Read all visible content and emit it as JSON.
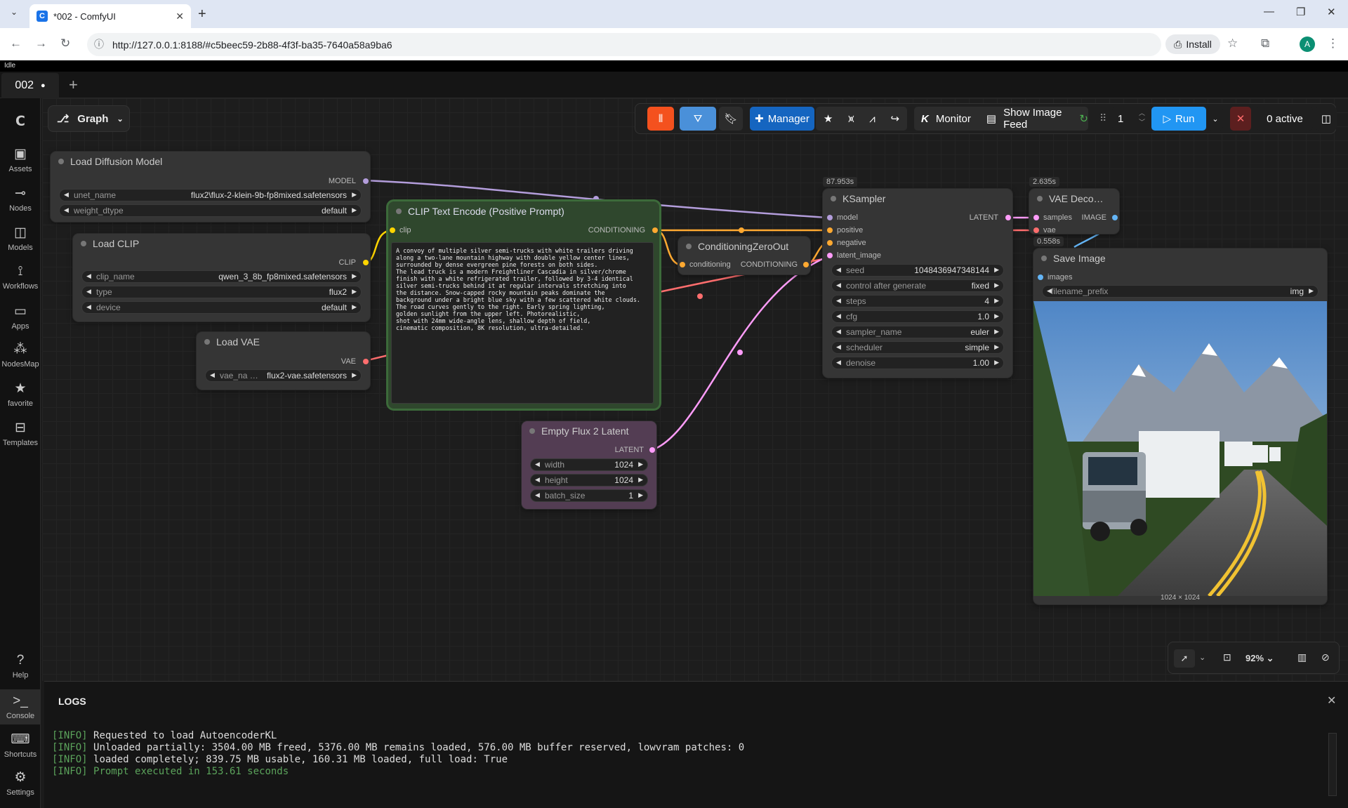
{
  "browser": {
    "tab_title": "*002 - ComfyUI",
    "favicon": "C",
    "url": "http://127.0.0.1:8188/#c5beec59-2b88-4f3f-ba35-7640a58a9ba6",
    "install_label": "Install",
    "avatar": "A"
  },
  "status": "Idle",
  "workflow_tab": {
    "label": "002",
    "modified_marker": "●"
  },
  "graph_label": "Graph",
  "sidebar": [
    {
      "label": "Assets",
      "icon": "image-icon"
    },
    {
      "label": "Nodes",
      "icon": "nodes-icon"
    },
    {
      "label": "Models",
      "icon": "models-icon"
    },
    {
      "label": "Workflows",
      "icon": "workflows-icon"
    },
    {
      "label": "Apps",
      "icon": "apps-icon"
    },
    {
      "label": "NodesMap",
      "icon": "nodesmap-icon"
    },
    {
      "label": "favorite",
      "icon": "star-icon"
    },
    {
      "label": "Templates",
      "icon": "templates-icon"
    },
    {
      "label": "Help",
      "icon": "help-icon"
    },
    {
      "label": "Console",
      "icon": "terminal-icon"
    },
    {
      "label": "Shortcuts",
      "icon": "keyboard-icon"
    },
    {
      "label": "Settings",
      "icon": "gear-icon"
    }
  ],
  "toolbar": {
    "manager": "Manager",
    "monitor": "Monitor",
    "show_image_feed": "Show Image Feed",
    "queue_count": "1",
    "run": "Run",
    "active": "0 active"
  },
  "nodes": {
    "load_diffusion": {
      "title": "Load Diffusion Model",
      "output": "MODEL",
      "unet_name_label": "unet_name",
      "unet_name": "flux2\\flux-2-klein-9b-fp8mixed.safetensors",
      "weight_dtype_label": "weight_dtype",
      "weight_dtype": "default"
    },
    "load_clip": {
      "title": "Load CLIP",
      "output": "CLIP",
      "clip_name_label": "clip_name",
      "clip_name": "qwen_3_8b_fp8mixed.safetensors",
      "type_label": "type",
      "type": "flux2",
      "device_label": "device",
      "device": "default"
    },
    "load_vae": {
      "title": "Load VAE",
      "output": "VAE",
      "vae_name_label": "vae_na …",
      "vae_name": "flux2-vae.safetensors"
    },
    "clip_encode": {
      "title": "CLIP Text Encode (Positive Prompt)",
      "input": "clip",
      "output": "CONDITIONING",
      "prompt": "A convoy of multiple silver semi-trucks with white trailers driving\nalong a two-lane mountain highway with double yellow center lines,\nsurrounded by dense evergreen pine forests on both sides.\nThe lead truck is a modern Freightliner Cascadia in silver/chrome\nfinish with a white refrigerated trailer, followed by 3-4 identical\nsilver semi-trucks behind it at regular intervals stretching into\nthe distance. Snow-capped rocky mountain peaks dominate the\nbackground under a bright blue sky with a few scattered white clouds.\nThe road curves gently to the right. Early spring lighting,\ngolden sunlight from the upper left. Photorealistic,\nshot with 24mm wide-angle lens, shallow depth of field,\ncinematic composition, 8K resolution, ultra-detailed."
    },
    "cond_zero": {
      "title": "ConditioningZeroOut",
      "input": "conditioning",
      "output": "CONDITIONING"
    },
    "ksampler": {
      "title": "KSampler",
      "timer": "87.953s",
      "inputs": [
        "model",
        "positive",
        "negative",
        "latent_image"
      ],
      "output": "LATENT",
      "widgets": [
        {
          "label": "seed",
          "value": "1048436947348144"
        },
        {
          "label": "control after generate",
          "value": "fixed"
        },
        {
          "label": "steps",
          "value": "4"
        },
        {
          "label": "cfg",
          "value": "1.0"
        },
        {
          "label": "sampler_name",
          "value": "euler"
        },
        {
          "label": "scheduler",
          "value": "simple"
        },
        {
          "label": "denoise",
          "value": "1.00"
        }
      ]
    },
    "vae_decode": {
      "title": "VAE Deco…",
      "timer": "2.635s",
      "inputs": [
        "samples",
        "vae"
      ],
      "output": "IMAGE"
    },
    "save_image": {
      "title": "Save Image",
      "timer": "0.558s",
      "input": "images",
      "prefix_label": "filename_prefix",
      "prefix": "img",
      "image_size": "1024 × 1024"
    },
    "empty_latent": {
      "title": "Empty Flux 2 Latent",
      "output": "LATENT",
      "width_label": "width",
      "width": "1024",
      "height_label": "height",
      "height": "1024",
      "batch_label": "batch_size",
      "batch": "1"
    }
  },
  "zoom": "92%",
  "logs": {
    "title": "LOGS",
    "lines": [
      {
        "tag": "[INFO]",
        "text": "Requested to load AutoencoderKL"
      },
      {
        "tag": "[INFO]",
        "text": "Unloaded partially: 3504.00 MB freed, 5376.00 MB remains loaded, 576.00 MB buffer reserved, lowvram patches: 0"
      },
      {
        "tag": "[INFO]",
        "text": "loaded completely; 839.75 MB usable, 160.31 MB loaded, full load: True"
      },
      {
        "tag": "[INFO]",
        "text": "Prompt executed in 153.61 seconds"
      }
    ]
  },
  "colors": {
    "model": "#b39ddb",
    "clip": "#ffd500",
    "vae": "#ff6e6e",
    "conditioning": "#ffa931",
    "latent": "#ff9cf9",
    "image": "#64b5f6",
    "run": "#2196f3",
    "clipnode": "#2f472d",
    "latentnode": "#533d53"
  }
}
